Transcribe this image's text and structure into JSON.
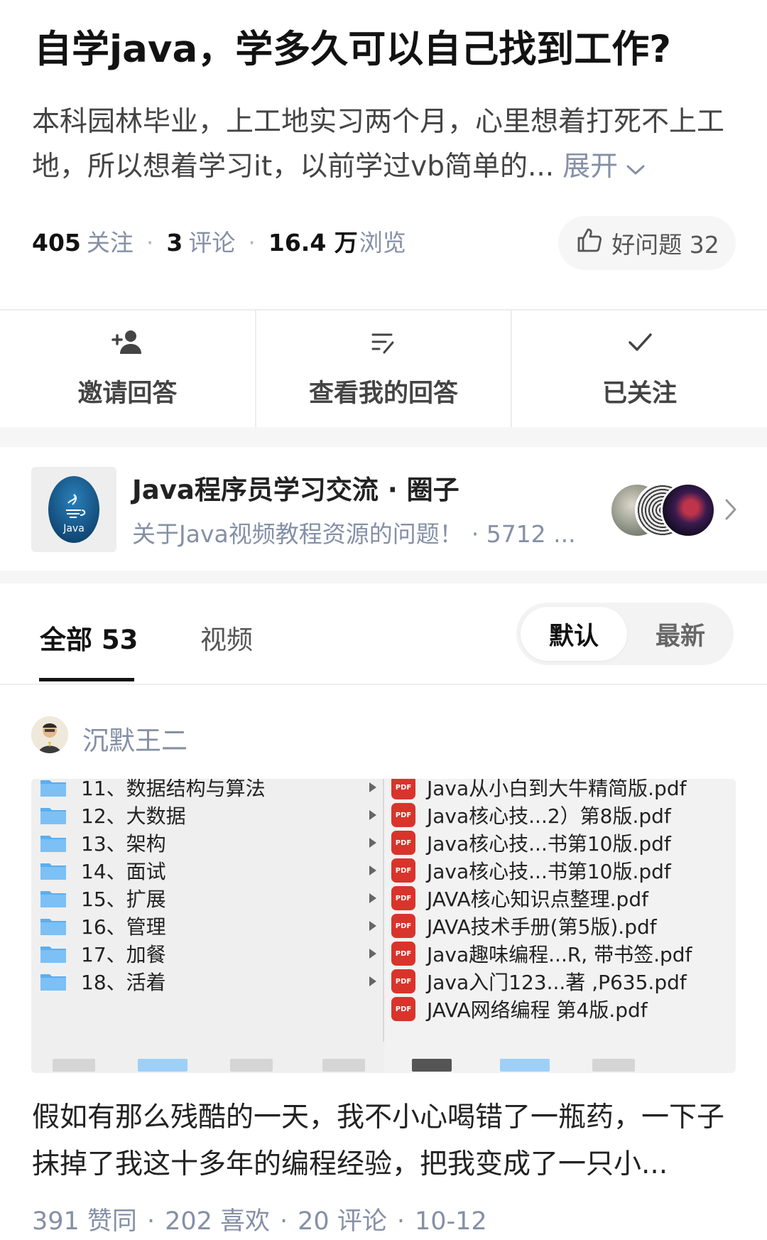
{
  "question": {
    "title": "自学java，学多久可以自己找到工作?",
    "description": "本科园林毕业，上工地实习两个月，心里想着打死不上工地，所以想着学习it，以前学过vb简单的...",
    "expand_label": "展开",
    "followers_count": "405",
    "followers_label": "关注",
    "comments_count": "3",
    "comments_label": "评论",
    "views_count": "16.4 万",
    "views_label": "浏览",
    "good_question_label": "好问题 32"
  },
  "actions": [
    {
      "label": "邀请回答",
      "icon": "add-person-icon"
    },
    {
      "label": "查看我的回答",
      "icon": "edit-list-icon"
    },
    {
      "label": "已关注",
      "icon": "checkmark-icon"
    }
  ],
  "circle": {
    "name": "Java程序员学习交流 · 圈子",
    "subtitle": "关于Java视频教程资源的问题！",
    "count": "· 5712 ...",
    "logo_text": "Java"
  },
  "tabs": {
    "all_label": "全部 53",
    "video_label": "视频",
    "sort_default": "默认",
    "sort_latest": "最新"
  },
  "answer": {
    "author": "沉默王二",
    "screenshot": {
      "folders": [
        "11、数据结构与算法",
        "12、大数据",
        "13、架构",
        "14、面试",
        "15、扩展",
        "16、管理",
        "17、加餐",
        "18、活着"
      ],
      "files": [
        "Java从小白到大牛精简版.pdf",
        "Java核心技...2）第8版.pdf",
        "Java核心技...书第10版.pdf",
        "Java核心技...书第10版.pdf",
        "JAVA核心知识点整理.pdf",
        "JAVA技术手册(第5版).pdf",
        "Java趣味编程...R, 带书签.pdf",
        "Java入门123...著 ,P635.pdf",
        "JAVA网络编程 第4版.pdf"
      ],
      "pdf_badge": "PDF"
    },
    "excerpt": "假如有那么残酷的一天，我不小心喝错了一瓶药，一下子抹掉了我这十多年的编程经验，把我变成了一只小...",
    "likes": "391 赞同",
    "favorites": "202 喜欢",
    "comments": "20 评论",
    "date": "10-12"
  },
  "colors": {
    "text_primary": "#121212",
    "text_secondary": "#8590a6",
    "pdf_red": "#d9342b",
    "folder_blue": "#5aaef0"
  }
}
